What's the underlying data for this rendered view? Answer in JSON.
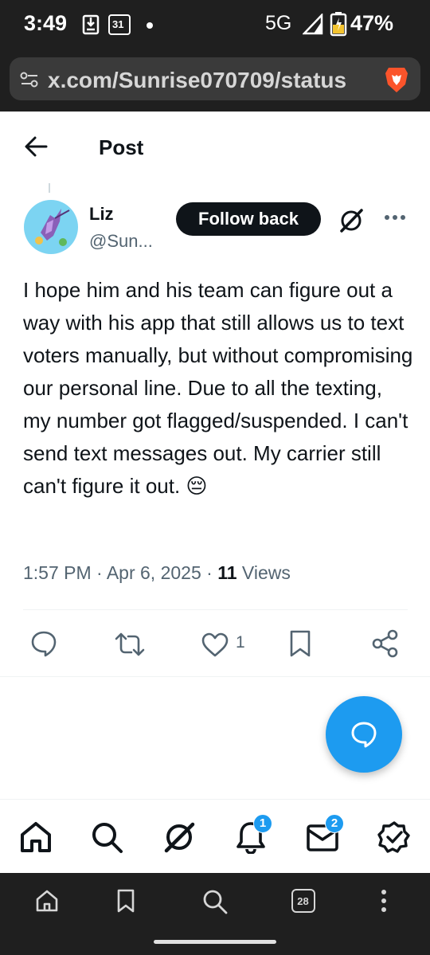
{
  "status_bar": {
    "time": "3:49",
    "calendar_day": "31",
    "network": "5G",
    "battery": "47%"
  },
  "browser": {
    "url": "x.com/Sunrise070709/status",
    "tab_count": "28"
  },
  "header": {
    "title": "Post"
  },
  "author": {
    "name": "Liz",
    "handle": "@Sun...",
    "follow_label": "Follow back"
  },
  "tweet": {
    "text": "I hope him and his team can figure out a way with his app that still allows us to text voters manually, but without compromising our personal line. Due to all the texting, my number got flagged/suspended. I can't send text messages out. My carrier still can't figure it out. 😔",
    "time": "1:57 PM",
    "date": "Apr 6, 2025",
    "views_count": "11",
    "views_label": "Views"
  },
  "actions": {
    "like_count": "1"
  },
  "bottom_nav": {
    "notifications_badge": "1",
    "messages_badge": "2"
  },
  "colors": {
    "accent": "#1d9bf0",
    "text_primary": "#0f1419",
    "text_secondary": "#536471",
    "chrome": "#1f1f1f"
  }
}
